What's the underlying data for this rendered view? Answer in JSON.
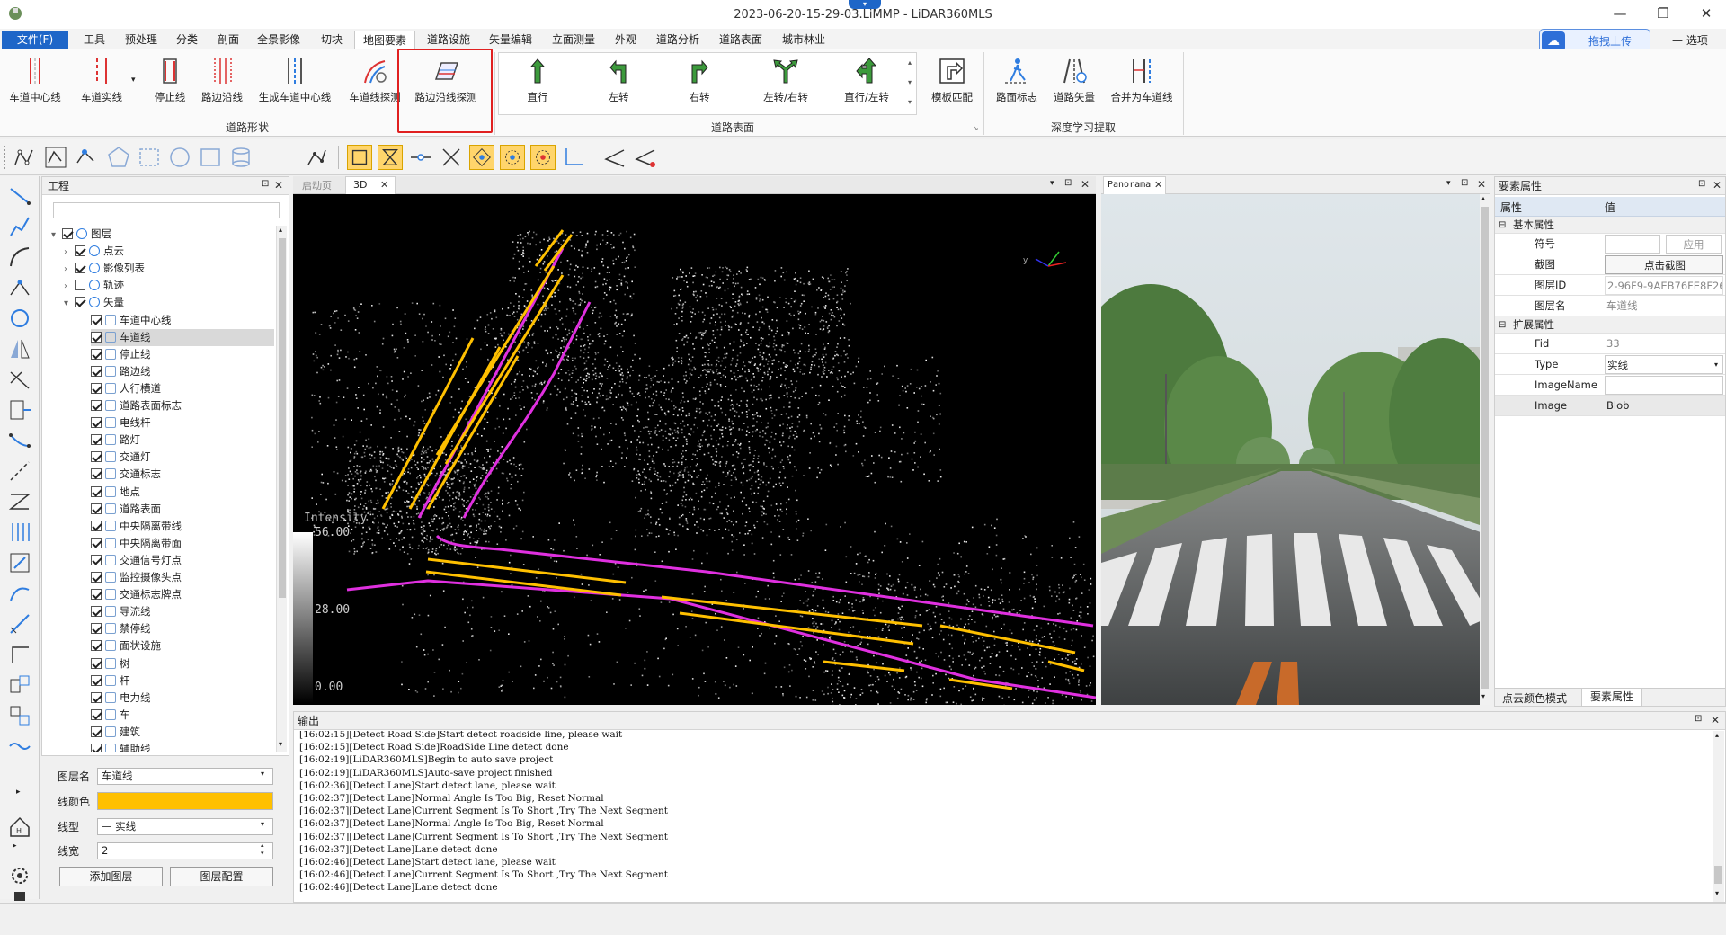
{
  "window": {
    "title": "2023-06-20-15-29-03.LiMMP - LiDAR360MLS",
    "minimize": "—",
    "maximize": "❐",
    "close": "✕"
  },
  "cloud": {
    "label": "拖拽上传"
  },
  "options": {
    "label": "选项"
  },
  "menu": {
    "file": "文件(F)",
    "tabs": [
      "工具",
      "预处理",
      "分类",
      "剖面",
      "全景影像",
      "切块",
      "地图要素",
      "道路设施",
      "矢量编辑",
      "立面测量",
      "外观",
      "道路分析",
      "道路表面",
      "城市林业"
    ]
  },
  "ribbon": {
    "road_shape": {
      "buttons": [
        "车道中心线",
        "车道实线",
        "停止线",
        "路边沿线",
        "生成车道中心线",
        "车道线探测",
        "路边沿线探测"
      ],
      "label": "道路形状"
    },
    "road_surface": {
      "buttons": [
        "直行",
        "左转",
        "右转",
        "左转/右转",
        "直行/左转"
      ],
      "label": "道路表面"
    },
    "template": {
      "button": "模板匹配"
    },
    "deep": {
      "buttons": [
        "路面标志",
        "道路矢量",
        "合并为车道线"
      ],
      "label": "深度学习提取"
    }
  },
  "project": {
    "title": "工程",
    "tree": [
      {
        "label": "图层",
        "level": 0,
        "checked": true,
        "expand": "▾"
      },
      {
        "label": "点云",
        "level": 1,
        "checked": true,
        "expand": "›"
      },
      {
        "label": "影像列表",
        "level": 1,
        "checked": true,
        "expand": "›"
      },
      {
        "label": "轨迹",
        "level": 1,
        "checked": false,
        "expand": "›"
      },
      {
        "label": "矢量",
        "level": 1,
        "checked": true,
        "expand": "▾"
      },
      {
        "label": "车道中心线",
        "level": 2,
        "checked": true
      },
      {
        "label": "车道线",
        "level": 2,
        "checked": true,
        "selected": true
      },
      {
        "label": "停止线",
        "level": 2,
        "checked": true
      },
      {
        "label": "路边线",
        "level": 2,
        "checked": true
      },
      {
        "label": "人行横道",
        "level": 2,
        "checked": true
      },
      {
        "label": "道路表面标志",
        "level": 2,
        "checked": true
      },
      {
        "label": "电线杆",
        "level": 2,
        "checked": true
      },
      {
        "label": "路灯",
        "level": 2,
        "checked": true
      },
      {
        "label": "交通灯",
        "level": 2,
        "checked": true
      },
      {
        "label": "交通标志",
        "level": 2,
        "checked": true
      },
      {
        "label": "地点",
        "level": 2,
        "checked": true
      },
      {
        "label": "道路表面",
        "level": 2,
        "checked": true
      },
      {
        "label": "中央隔离带线",
        "level": 2,
        "checked": true
      },
      {
        "label": "中央隔离带面",
        "level": 2,
        "checked": true
      },
      {
        "label": "交通信号灯点",
        "level": 2,
        "checked": true
      },
      {
        "label": "监控摄像头点",
        "level": 2,
        "checked": true
      },
      {
        "label": "交通标志牌点",
        "level": 2,
        "checked": true
      },
      {
        "label": "导流线",
        "level": 2,
        "checked": true
      },
      {
        "label": "禁停线",
        "level": 2,
        "checked": true
      },
      {
        "label": "面状设施",
        "level": 2,
        "checked": true
      },
      {
        "label": "树",
        "level": 2,
        "checked": true
      },
      {
        "label": "杆",
        "level": 2,
        "checked": true
      },
      {
        "label": "电力线",
        "level": 2,
        "checked": true
      },
      {
        "label": "车",
        "level": 2,
        "checked": true
      },
      {
        "label": "建筑",
        "level": 2,
        "checked": true
      },
      {
        "label": "辅助线",
        "level": 2,
        "checked": true
      }
    ]
  },
  "layer_props": {
    "name_label": "图层名",
    "name_value": "车道线",
    "color_label": "线颜色",
    "color_value": "#ffc000",
    "type_label": "线型",
    "type_value": "— 实线",
    "width_label": "线宽",
    "width_value": "2",
    "add_button": "添加图层",
    "config_button": "图层配置"
  },
  "viewer": {
    "tabs": [
      "启动页",
      "3D"
    ],
    "legend_title": "Intensity",
    "legend_values": [
      "56.00",
      "28.00",
      "0.00"
    ]
  },
  "panorama": {
    "title": "Panorama"
  },
  "element_props": {
    "title": "要素属性",
    "col_attr": "属性",
    "col_value": "值",
    "basic_group": "基本属性",
    "rows_basic": [
      {
        "key": "符号",
        "value": "",
        "action": "应用"
      },
      {
        "key": "截图",
        "value": "点击截图"
      },
      {
        "key": "图层ID",
        "value": "2-96F9-9AEB76FE8F26}"
      },
      {
        "key": "图层名",
        "value": "车道线"
      }
    ],
    "ext_group": "扩展属性",
    "rows_ext": [
      {
        "key": "Fid",
        "value": "33"
      },
      {
        "key": "Type",
        "value": "实线"
      },
      {
        "key": "ImageName",
        "value": ""
      },
      {
        "key": "Image",
        "value": "Blob"
      }
    ],
    "bottom_tabs": [
      "点云颜色模式",
      "要素属性"
    ]
  },
  "output": {
    "title": "输出",
    "lines": [
      "[16:02:15][Detect Road Side]Start detect roadside line, please wait",
      "[16:02:15][Detect Road Side]RoadSide Line detect done",
      "[16:02:19][LiDAR360MLS]Begin to auto save project",
      "[16:02:19][LiDAR360MLS]Auto-save project finished",
      "[16:02:36][Detect Lane]Start detect lane, please wait",
      "[16:02:37][Detect Lane]Normal Angle Is Too Big, Reset Normal",
      "[16:02:37][Detect Lane]Current Segment Is To Short ,Try The Next Segment",
      "[16:02:37][Detect Lane]Normal Angle Is Too Big, Reset Normal",
      "[16:02:37][Detect Lane]Current Segment Is To Short ,Try The Next Segment",
      "[16:02:37][Detect Lane]Lane detect done",
      "[16:02:46][Detect Lane]Start detect lane, please wait",
      "[16:02:46][Detect Lane]Current Segment Is To Short ,Try The Next Segment",
      "[16:02:46][Detect Lane]Lane detect done"
    ]
  },
  "colors": {
    "accent": "#1e66c8",
    "highlight": "#e02020",
    "lane_yellow": "#ffc000",
    "roadside_magenta": "#e030e0"
  }
}
